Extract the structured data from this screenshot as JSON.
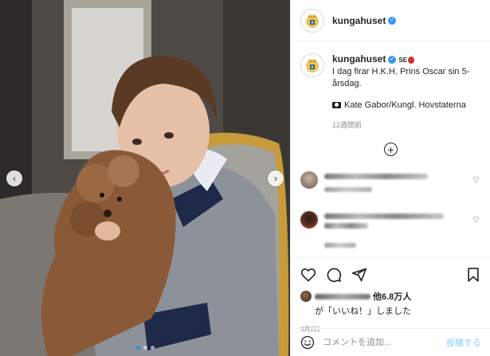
{
  "media": {
    "page_dots": 3,
    "active_dot": 0
  },
  "header": {
    "username": "kungahuset",
    "verified": true
  },
  "caption": {
    "username": "kungahuset",
    "flag_text": "SE",
    "text": "I dag firar H.K.H. Prins Oscar sin 5-årsdag.",
    "credit": "Kate Gabor/Kungl. Hovstaterna",
    "time": "12週間前"
  },
  "comments_blurred": 2,
  "actions": {
    "likes_count": "他6.8万人",
    "likes_suffix": "が「いいね！」しました",
    "date": "3月2日"
  },
  "add_comment": {
    "placeholder": "コメントを追加...",
    "post_label": "投稿する"
  },
  "colors": {
    "verified_blue": "#3897f0",
    "active_dot": "#2f8be6",
    "post_button_disabled": "#b2dffc",
    "border": "#efefef",
    "muted_text": "#8e8e8e"
  }
}
